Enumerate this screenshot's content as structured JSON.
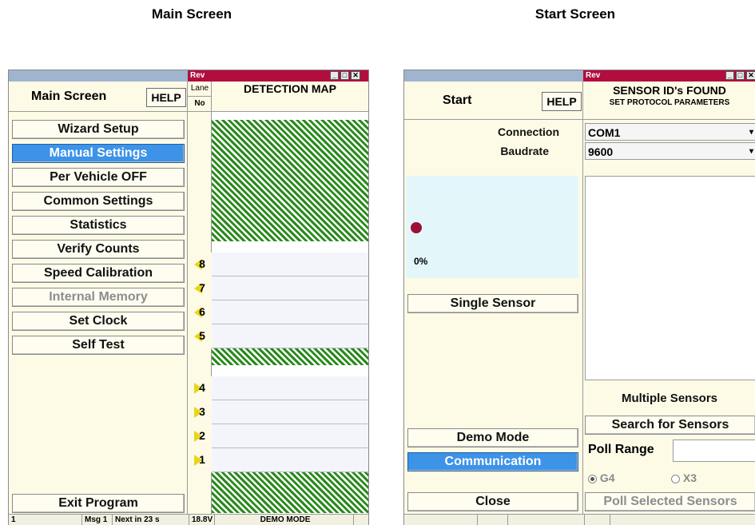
{
  "captions": {
    "left": "Main Screen",
    "right": "Start Screen"
  },
  "main_window": {
    "rev_label": "Rev",
    "title": "Main Screen",
    "help_label": "HELP",
    "lane_header_top": "Lane",
    "lane_header_bottom": "No",
    "detection_map_title": "DETECTION MAP",
    "menu": [
      {
        "label": "Wizard Setup",
        "state": "normal"
      },
      {
        "label": "Manual Settings",
        "state": "selected"
      },
      {
        "label": "Per Vehicle OFF",
        "state": "normal"
      },
      {
        "label": "Common Settings",
        "state": "normal"
      },
      {
        "label": "Statistics",
        "state": "normal"
      },
      {
        "label": "Verify Counts",
        "state": "normal"
      },
      {
        "label": "Speed Calibration",
        "state": "normal"
      },
      {
        "label": "Internal Memory",
        "state": "disabled"
      },
      {
        "label": "Set Clock",
        "state": "normal"
      },
      {
        "label": "Self Test",
        "state": "normal"
      }
    ],
    "exit_label": "Exit Program",
    "lanes_left_direction": [
      "8",
      "7",
      "6",
      "5"
    ],
    "lanes_right_direction": [
      "4",
      "3",
      "2",
      "1"
    ],
    "status": {
      "id": "1",
      "msg": "Msg 1",
      "next": "Next in 23 s",
      "voltage": "18.8V",
      "mode": "DEMO MODE"
    }
  },
  "start_window": {
    "rev_label": "Rev",
    "title": "Start",
    "help_label": "HELP",
    "sensor_header": "SENSOR ID's FOUND",
    "protocol_header": "SET PROTOCOL PARAMETERS",
    "connection_label": "Connection",
    "connection_value": "COM1",
    "baudrate_label": "Baudrate",
    "baudrate_value": "9600",
    "progress_text": "0%",
    "progress_value": 0,
    "single_sensor_label": "Single Sensor",
    "multiple_sensors_label": "Multiple Sensors",
    "demo_mode_label": "Demo Mode",
    "search_label": "Search for Sensors",
    "communication_label": "Communication",
    "poll_range_label": "Poll Range",
    "poll_range_value": "",
    "radio_g4": "G4",
    "radio_x3": "X3",
    "radio_selected": "G4",
    "close_label": "Close",
    "poll_selected_label": "Poll Selected Sensors"
  },
  "colors": {
    "accent": "#3c93e8",
    "rev_bar": "#b10d3e",
    "hatch": "#2a8a1c",
    "panel": "#fdfbe6"
  }
}
